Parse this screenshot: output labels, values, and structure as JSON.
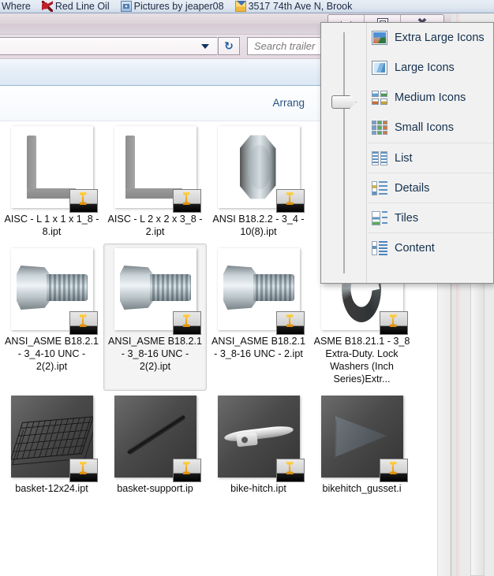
{
  "bookmarks": [
    {
      "label": "Where",
      "icon": "none"
    },
    {
      "label": "Red Line Oil",
      "icon": "redline-icon"
    },
    {
      "label": "Pictures by jeaper08",
      "icon": "picture-icon"
    },
    {
      "label": "3517 74th Ave N, Brook",
      "icon": "folder-pin-icon"
    }
  ],
  "window": {
    "buttons": {
      "minimize": "Minimize",
      "maximize": "Maximize",
      "close": "Close"
    }
  },
  "navbar": {
    "address_value": "",
    "dropdown_icon": "chevron-down-icon",
    "refresh_icon": "refresh-icon",
    "refresh_glyph": "↻",
    "search_placeholder": "Search trailer"
  },
  "command_bar": {
    "arrange_label": "Arrang",
    "arrange_full": "Arrange by",
    "preview_pane_icon": "preview-pane-icon",
    "help_icon": "help-icon"
  },
  "view_menu": {
    "slider": {
      "name": "icon-size-slider",
      "value_label": "Large Icons",
      "position_percent": 28
    },
    "items": [
      {
        "label": "Extra Large Icons",
        "icon": "extra-large-icons-icon",
        "separator": false
      },
      {
        "label": "Large Icons",
        "icon": "large-icons-icon",
        "separator": false
      },
      {
        "label": "Medium Icons",
        "icon": "medium-icons-icon",
        "separator": false
      },
      {
        "label": "Small Icons",
        "icon": "small-icons-icon",
        "separator": false
      },
      {
        "label": "List",
        "icon": "list-icon",
        "separator": true
      },
      {
        "label": "Details",
        "icon": "details-icon",
        "separator": true
      },
      {
        "label": "Tiles",
        "icon": "tiles-icon",
        "separator": true
      },
      {
        "label": "Content",
        "icon": "content-icon",
        "separator": true
      }
    ]
  },
  "files": {
    "rows": [
      [
        {
          "label": "AISC - L 1 x 1 x 1_8 - 8.ipt",
          "art": "angle",
          "dark": false,
          "selected": false
        },
        {
          "label": "AISC - L 2 x 2 x 3_8 - 2.ipt",
          "art": "angle-wide",
          "dark": false,
          "selected": false
        },
        {
          "label": "ANSI B18.2.2 - 3_4 - 10(8).ipt",
          "art": "nut",
          "dark": false,
          "selected": false
        },
        {
          "label": "",
          "art": "hidden",
          "dark": false,
          "selected": false
        }
      ],
      [
        {
          "label": "ANSI_ASME B18.2.1 - 3_4-10 UNC - 2(2).ipt",
          "art": "bolt",
          "dark": false,
          "selected": false
        },
        {
          "label": "ANSI_ASME B18.2.1 - 3_8-16 UNC - 2(2).ipt",
          "art": "bolt",
          "dark": false,
          "selected": true
        },
        {
          "label": "ANSI_ASME B18.2.1 - 3_8-16 UNC - 2.ipt",
          "art": "bolt",
          "dark": false,
          "selected": false
        },
        {
          "label": "ASME B18.21.1 - 3_8  Extra-Duty. Lock Washers (Inch Series)Extr...",
          "art": "washer",
          "dark": false,
          "selected": false
        }
      ],
      [
        {
          "label": "basket-12x24.ipt",
          "art": "basket",
          "dark": true,
          "selected": false
        },
        {
          "label": "basket-support.ip",
          "art": "rod",
          "dark": true,
          "selected": false
        },
        {
          "label": "bike-hitch.ipt",
          "art": "hitch",
          "dark": true,
          "selected": false
        },
        {
          "label": "bikehitch_gusset.i",
          "art": "gusset",
          "dark": true,
          "selected": false
        }
      ]
    ]
  },
  "colors": {
    "menu_text": "#14304e",
    "titlebar": "#ddd3da",
    "command_bar": "#e5eef7",
    "selection": "#f4f4f4",
    "arrange_text": "#2b5480"
  }
}
